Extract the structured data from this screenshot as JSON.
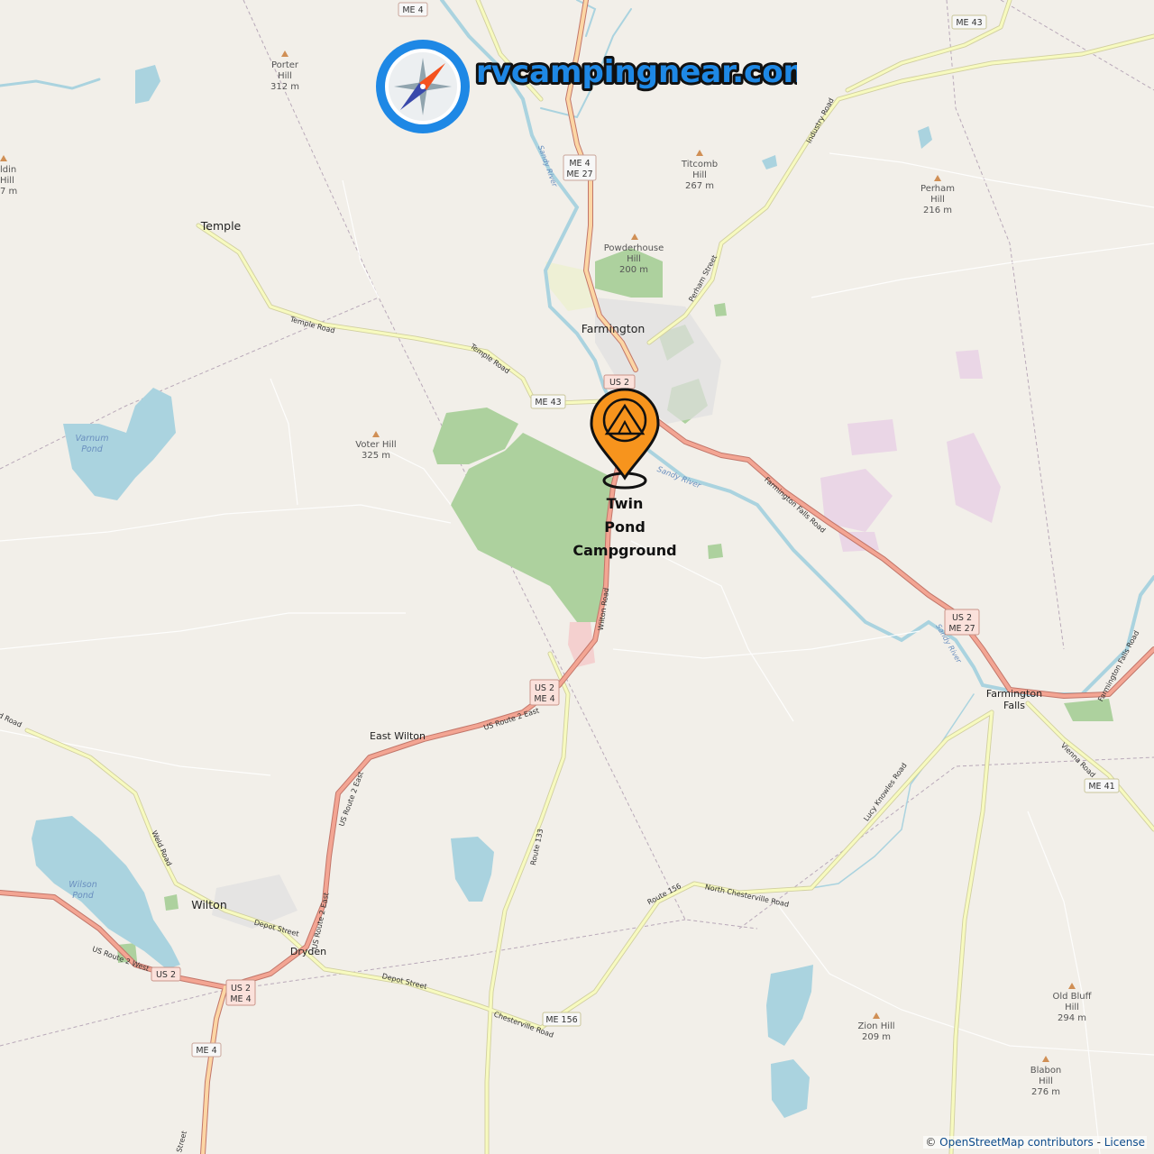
{
  "brand": {
    "text": "rvcampingnear.com"
  },
  "campground": {
    "name_lines": [
      "Twin",
      "Pond",
      "Campground"
    ]
  },
  "towns": {
    "farmington": "Farmington",
    "temple": "Temple",
    "east_wilton": "East Wilton",
    "wilton": "Wilton",
    "dryden": "Dryden",
    "farmington_falls_1": "Farmington",
    "farmington_falls_2": "Falls",
    "baldwin_1": "ldin",
    "baldwin_2": "Hill",
    "baldwin_3": "7 m"
  },
  "hills": {
    "porter": [
      "Porter",
      "Hill",
      "312 m"
    ],
    "titcomb": [
      "Titcomb",
      "Hill",
      "267 m"
    ],
    "perham": [
      "Perham",
      "Hill",
      "216 m"
    ],
    "powderhouse": [
      "Powderhouse",
      "Hill",
      "200 m"
    ],
    "voter": [
      "Voter Hill",
      "325 m"
    ],
    "zion": [
      "Zion Hill",
      "209 m"
    ],
    "old_bluff": [
      "Old Bluff",
      "Hill",
      "294 m"
    ],
    "blabon": [
      "Blabon",
      "Hill",
      "276 m"
    ]
  },
  "water": {
    "varnum": [
      "Varnum",
      "Pond"
    ],
    "wilson": [
      "Wilson",
      "Pond"
    ],
    "sandy_river": "Sandy River"
  },
  "roads": {
    "temple_road": "Temple Road",
    "industry_road": "Industry Road",
    "perham_street": "Perham Street",
    "farmington_falls_road": "Farmington Falls Road",
    "wilton_road": "Wilton Road",
    "us_route_2_east": "US Route 2 East",
    "us_route_2_west": "US Route 2 West",
    "route_133": "Route 133",
    "route_156": "Route 156",
    "north_chesterville_road": "North Chesterville Road",
    "lucy_knowles_road": "Lucy Knowles Road",
    "vienna_road": "Vienna Road",
    "weld_road": "Weld Road",
    "depot_street": "Depot Street",
    "chesterville_road": "Chesterville Road",
    "d_road": "d Road",
    "street": "Street"
  },
  "shields": {
    "me4_top": "ME 4",
    "me43_top": "ME 43",
    "me4_27_a": "ME 4",
    "me4_27_b": "ME 27",
    "me43_mid": "ME 43",
    "us2_farm": "US 2",
    "us2_me27_a": "US 2",
    "us2_me27_b": "ME 27",
    "us2_me4_a": "US 2",
    "us2_me4_b": "ME 4",
    "me41": "ME 41",
    "us2_wilton": "US 2",
    "us2_me4_wilton_a": "US 2",
    "us2_me4_wilton_b": "ME 4",
    "me4_bottom": "ME 4",
    "me156": "ME 156"
  },
  "attribution": {
    "prefix": "© ",
    "osm": "OpenStreetMap contributors",
    "sep": " - ",
    "license": "License"
  },
  "colors": {
    "land": "#f2efe9",
    "water": "#aad3df",
    "park": "#add19e",
    "primary_road": "#e8927c",
    "secondary_road": "#f7fabf",
    "marker": "#f7941d",
    "brand_blue": "#1e88e5"
  }
}
